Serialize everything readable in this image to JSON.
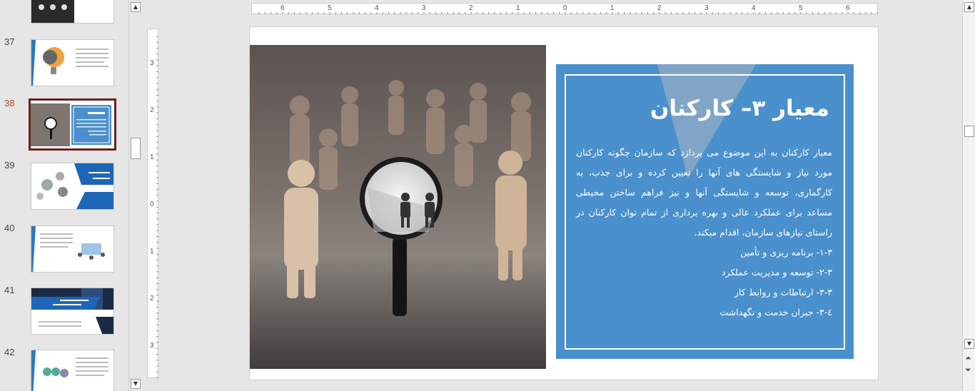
{
  "thumbnails": [
    {
      "number": "",
      "selected": false
    },
    {
      "number": "37",
      "selected": false
    },
    {
      "number": "38",
      "selected": true
    },
    {
      "number": "39",
      "selected": false
    },
    {
      "number": "40",
      "selected": false
    },
    {
      "number": "41",
      "selected": false
    },
    {
      "number": "42",
      "selected": false
    }
  ],
  "ruler": {
    "horizontal_ticks": [
      "6",
      "5",
      "4",
      "3",
      "2",
      "1",
      "0",
      "1",
      "2",
      "3",
      "4",
      "5",
      "6"
    ],
    "vertical_ticks": [
      "3",
      "2",
      "1",
      "0",
      "1",
      "2",
      "3"
    ]
  },
  "slide": {
    "title": "معیار ۳– کارکنان",
    "body": "معیار کارکنان به این موضوع می پردازد که سازمان چگونه کارکنان مورد نیاز و شایستگی های آنها را تعیین کرده و برای جذب، به کارگماری، توسعه و شایستگی آنها و نیز فراهم ساختن محیطی مساعد برای عملکرد عالی و بهره برداری از تمام توان کارکنان در راستای نیازهای سازمان، اقدام میکند.",
    "bullets": [
      "۱-۳- برنامه ریزی و تأمین",
      "۲-۳- توسعه و مدیریت عملکرد",
      "۳-۳- ارتباطات و روابط کار",
      "٤-۳- جبران خدمت و نگهداشت"
    ],
    "colors": {
      "panel": "#4a90cc",
      "frame": "#ffffff",
      "triangle": "#8aa9c4"
    }
  },
  "icons": [
    "scroll-up-icon",
    "scroll-down-icon",
    "prev-slide-icon",
    "next-slide-icon"
  ]
}
